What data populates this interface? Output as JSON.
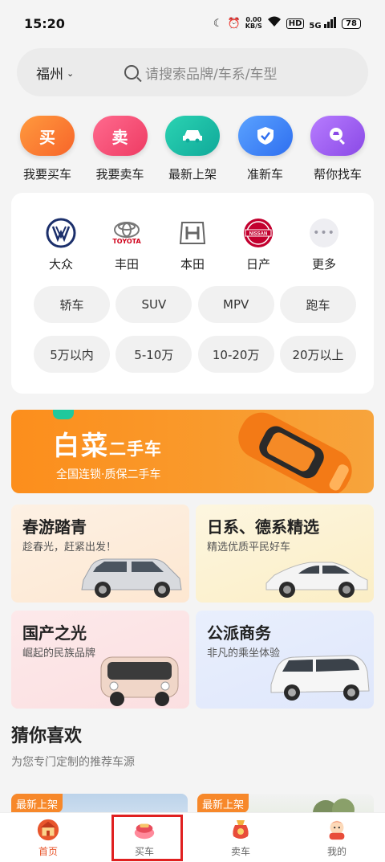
{
  "status": {
    "time": "15:20",
    "net_speed_value": "0.00",
    "net_speed_unit": "KB/S",
    "hd": "HD",
    "signal": "5G",
    "battery": "78"
  },
  "search": {
    "city": "福州",
    "placeholder": "请搜索品牌/车系/车型"
  },
  "quick": [
    {
      "icon_text": "买",
      "label": "我要买车",
      "color": "#f9742a"
    },
    {
      "icon_text": "卖",
      "label": "我要卖车",
      "color": "#f2466c"
    },
    {
      "icon_text": "",
      "label": "最新上架",
      "color": "#18b8a4"
    },
    {
      "icon_text": "",
      "label": "准新车",
      "color": "#3d86f0"
    },
    {
      "icon_text": "",
      "label": "帮你找车",
      "color": "#9b5ce8"
    }
  ],
  "brands": [
    {
      "name": "大众",
      "logo_text": "VW"
    },
    {
      "name": "丰田",
      "logo_text": "TOYOTA"
    },
    {
      "name": "本田",
      "logo_text": "H"
    },
    {
      "name": "日产",
      "logo_text": "NISSAN"
    },
    {
      "name": "更多",
      "logo_text": "•••"
    }
  ],
  "body_types": [
    "轿车",
    "SUV",
    "MPV",
    "跑车"
  ],
  "price_ranges": [
    "5万以内",
    "5-10万",
    "10-20万",
    "20万以上"
  ],
  "banner": {
    "title_main": "白菜",
    "title_suffix": "二手车",
    "subtitle": "全国连锁·质保二手车"
  },
  "categories": [
    {
      "title": "春游踏青",
      "subtitle": "趁春光，赶紧出发！"
    },
    {
      "title": "日系、德系精选",
      "subtitle": "精选优质平民好车"
    },
    {
      "title": "国产之光",
      "subtitle": "崛起的民族品牌"
    },
    {
      "title": "公派商务",
      "subtitle": "非凡的乘坐体验"
    }
  ],
  "recommend": {
    "title": "猜你喜欢",
    "subtitle": "为您专门定制的推荐车源",
    "badge": "最新上架"
  },
  "tabs": [
    {
      "label": "首页",
      "active": true
    },
    {
      "label": "买车",
      "active": false
    },
    {
      "label": "卖车",
      "active": false
    },
    {
      "label": "我的",
      "active": false
    }
  ]
}
